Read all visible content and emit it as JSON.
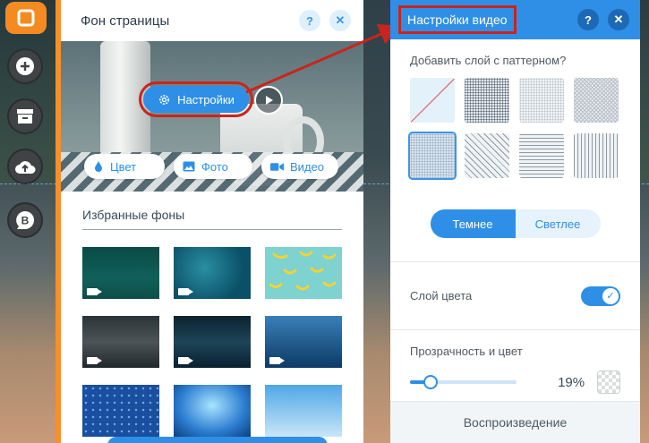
{
  "toolbar": {
    "items": [
      {
        "icon": "app-logo-icon"
      },
      {
        "icon": "add-icon"
      },
      {
        "icon": "store-icon"
      },
      {
        "icon": "upload-icon"
      },
      {
        "icon": "blog-icon",
        "label": "B"
      }
    ]
  },
  "left_panel": {
    "title": "Фон страницы",
    "help": "?",
    "close": "✕",
    "settings_label": "Настройки",
    "media_buttons": [
      {
        "icon": "color-drop-icon",
        "label": "Цвет"
      },
      {
        "icon": "photo-icon",
        "label": "Фото"
      },
      {
        "icon": "video-camera-icon",
        "label": "Видео"
      }
    ],
    "favorites_title": "Избранные фоны"
  },
  "right_panel": {
    "title": "Настройки видео",
    "help": "?",
    "close": "✕",
    "pattern_label": "Добавить слой с паттерном?",
    "tone": {
      "darker": "Темнее",
      "lighter": "Светлее",
      "selected": "darker"
    },
    "color_layer_label": "Слой цвета",
    "color_layer_on": true,
    "opacity_label": "Прозрачность и цвет",
    "opacity_value": 19,
    "opacity_display": "19%",
    "playback_label": "Воспроизведение"
  },
  "colors": {
    "accent": "#2f8fe6",
    "highlight": "#c8251d",
    "editor_orange": "#f7902a"
  }
}
